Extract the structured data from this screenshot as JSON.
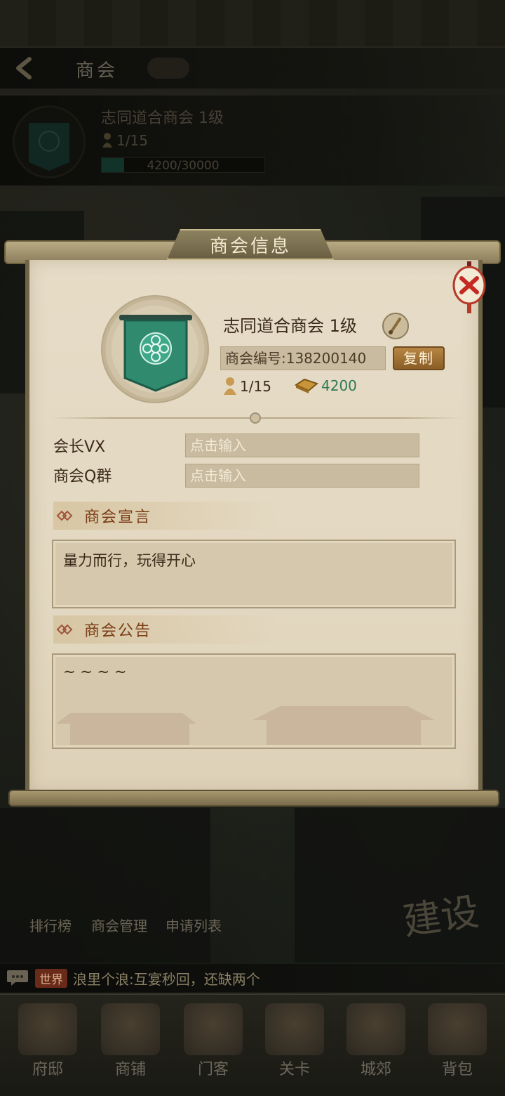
{
  "header": {
    "title": "商会"
  },
  "summary": {
    "name": "志同道合商会 1级",
    "members": "1/15",
    "exp_text": "4200/30000",
    "exp_progress": 0.14
  },
  "dialog": {
    "title": "商会信息",
    "guild_name": "志同道合商会 1级",
    "guild_id": "商会编号:138200140",
    "copy_label": "复制",
    "members": "1/15",
    "funds": "4200",
    "fields": [
      {
        "label": "会长VX",
        "placeholder": "点击输入"
      },
      {
        "label": "商会Q群",
        "placeholder": "点击输入"
      }
    ],
    "declaration": {
      "title": "商会宣言",
      "text": "量力而行，玩得开心"
    },
    "announcement": {
      "title": "商会公告",
      "text": "~ ~ ~ ~"
    }
  },
  "shortcuts": [
    "排行榜",
    "商会管理",
    "申请列表"
  ],
  "build_label": "建设",
  "chat": {
    "channel": "世界",
    "message": "浪里个浪:互宴秒回，还缺两个"
  },
  "nav": [
    "府邸",
    "商铺",
    "门客",
    "关卡",
    "城郊",
    "背包"
  ],
  "colors": {
    "accent_green": "#2f7a55",
    "copy_button": "#a2722f",
    "section_title": "#7a3d16",
    "paper": "#e4d9c2"
  }
}
